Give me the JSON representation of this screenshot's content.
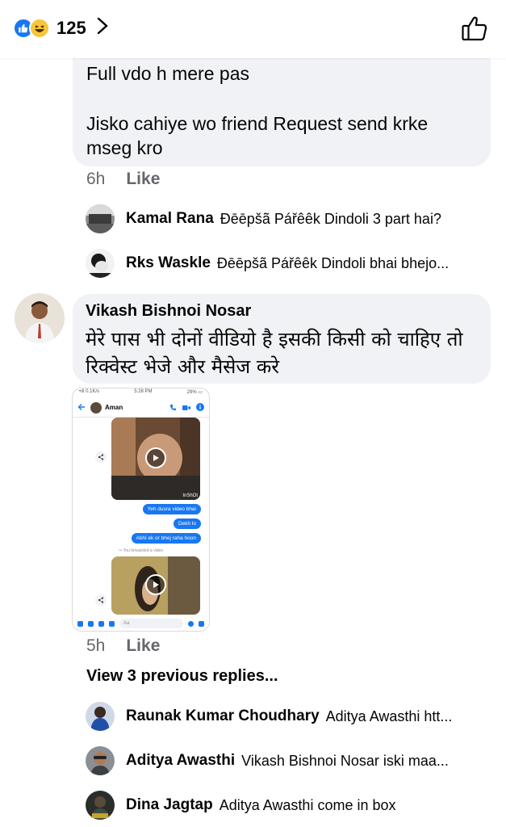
{
  "header": {
    "reaction_count": "125",
    "reaction_icons": [
      "like-icon",
      "haha-icon"
    ],
    "chevron_icon": "chevron-right-icon",
    "like_button_icon": "thumbs-up-outline-icon"
  },
  "comment1": {
    "line1": "Full vdo h mere pas",
    "line2": "Jisko cahiye wo friend Request send krke",
    "line3": "mseg kro",
    "time": "6h",
    "like_label": "Like"
  },
  "replies_top": [
    {
      "name": "Kamal Rana",
      "text": "Đēēpšã Pářêêk Dindoli 3 part hai?"
    },
    {
      "name": "Rks Waskle",
      "text": "Đēēpšã Pářêêk Dindoli  bhai bhejo..."
    }
  ],
  "comment2": {
    "author": "Vikash Bishnoi Nosar",
    "line1": "मेरे पास भी दोनों वीडियो है इसकी किसी को चाहिए तो",
    "line2": "रिक्वेस्ट भेजे और मैसेज करे",
    "time": "5h",
    "like_label": "Like",
    "attachment": {
      "status_left": "•ıll 0.1K/s",
      "status_time": "5:28 PM",
      "status_right": "29% ▭",
      "contact": "Aman",
      "watermark": "InShOt",
      "messages": [
        "Yeh dusra video  bhai",
        "Dekh lo",
        "Abhi ek or bhej raha hoon"
      ],
      "forwarded": "↪ You forwarded a video",
      "input_placeholder": "Aa"
    }
  },
  "view_previous": "View 3 previous replies...",
  "replies_bottom": [
    {
      "name": "Raunak Kumar Choudhary",
      "text": "Aditya Awasthi htt..."
    },
    {
      "name": "Aditya Awasthi",
      "text": "Vikash Bishnoi Nosar iski maa..."
    },
    {
      "name": "Dina Jagtap",
      "text": "Aditya Awasthi come in box"
    }
  ],
  "colors": {
    "bubble": "#f0f2f5",
    "meta": "#65676b",
    "brand": "#1877f2",
    "text": "#050505"
  }
}
